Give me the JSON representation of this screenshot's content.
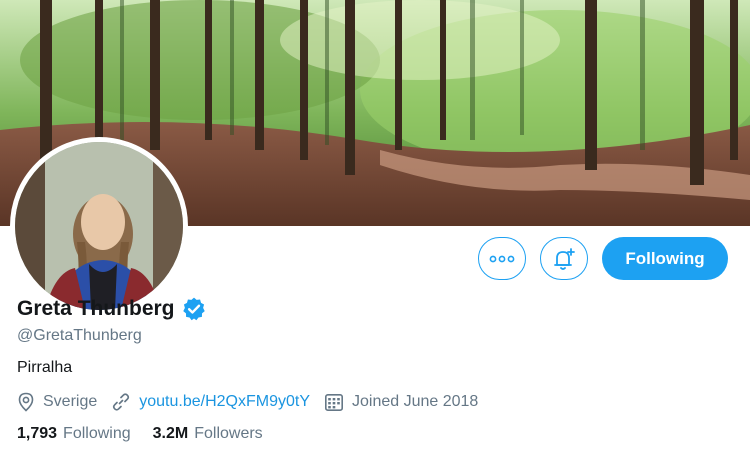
{
  "profile": {
    "name": "Greta Thunberg",
    "handle": "@GretaThunberg",
    "bio": "Pirralha",
    "location": "Sverige",
    "website": "youtu.be/H2QxFM9y0tY",
    "joined": "Joined June 2018",
    "verified": true
  },
  "actions": {
    "following_label": "Following",
    "more_icon": "more-icon",
    "notify_icon": "bell-plus-icon"
  },
  "stats": [
    {
      "value": "1,793",
      "label": "Following"
    },
    {
      "value": "3.2M",
      "label": "Followers"
    }
  ],
  "icons": {
    "location": "location-pin-icon",
    "link": "link-icon",
    "calendar": "calendar-icon",
    "verified": "verified-badge-icon"
  },
  "colors": {
    "accent": "#1da1f2",
    "link": "#1b95e0",
    "secondary_text": "#657786",
    "primary_text": "#14171a"
  }
}
